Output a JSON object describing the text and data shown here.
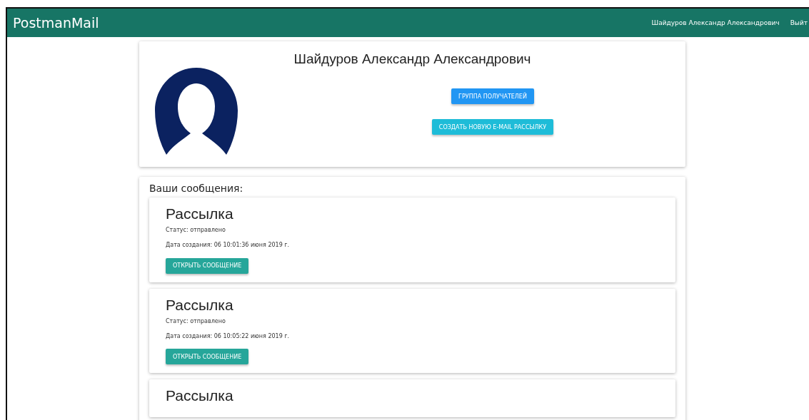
{
  "navbar": {
    "brand": "PostmanMail",
    "user": "Шайдуров Александр Александрович",
    "logout": "Выйт"
  },
  "profile": {
    "name": "Шайдуров Александр Александрович",
    "buttons": [
      {
        "label": "ГРУППА ПОЛУЧАТЕЛЕЙ",
        "kind": "primary"
      },
      {
        "label": "СОЗДАТЬ НОВУЮ E-MAIL РАССЫЛКУ",
        "kind": "info"
      }
    ]
  },
  "messages": {
    "heading": "Ваши сообщения:",
    "items": [
      {
        "title": "Рассылка",
        "status": "Статус: отправлено",
        "created": "Дата создания: 06 10:01:36 июня 2019 г.",
        "button": "ОТКРЫТЬ СООБЩЕНИЕ"
      },
      {
        "title": "Рассылка",
        "status": "Статус: отправлено",
        "created": "Дата создания: 06 10:05:22 июня 2019 г.",
        "button": "ОТКРЫТЬ СООБЩЕНИЕ"
      },
      {
        "title": "Рассылка"
      }
    ]
  }
}
